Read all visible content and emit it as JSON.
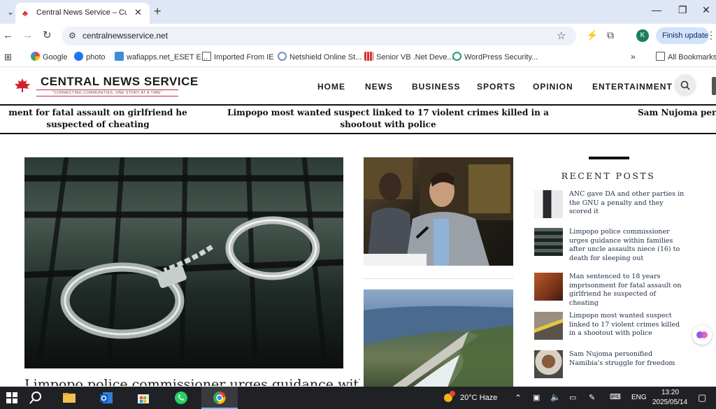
{
  "browser": {
    "tab_title": "Central News Service – Current",
    "url": "centralnewsservice.net",
    "update_label": "Finish update",
    "avatar_letter": "K",
    "bookmarks": [
      {
        "label": "Google",
        "icon": "google-icon"
      },
      {
        "label": "photo",
        "icon": "facebook-icon"
      },
      {
        "label": "wafiapps.net_ESET E...",
        "icon": "eset-icon"
      },
      {
        "label": "Imported From IE",
        "icon": "folder-icon"
      },
      {
        "label": "Netshield Online St...",
        "icon": "netshield-icon"
      },
      {
        "label": "Senior VB .Net Deve...",
        "icon": "grid-icon"
      },
      {
        "label": "WordPress Security...",
        "icon": "refresh-icon"
      }
    ],
    "all_bookmarks_label": "All Bookmarks"
  },
  "site": {
    "brand": "CENTRAL NEWS SERVICE",
    "tagline": "\"CONNECTING COMMUNITIES, ONE STORY AT A TIME\"",
    "nav": [
      "HOME",
      "NEWS",
      "BUSINESS",
      "SPORTS",
      "OPINION",
      "ENTERTAINMENT"
    ],
    "accent_color": "#c6283a"
  },
  "ticker": [
    "ment for fatal assault on girlfriend he suspected of cheating",
    "Limpopo most wanted suspect linked to 17 violent crimes killed in a shootout with police",
    "Sam Nujoma perso"
  ],
  "main": {
    "headline": "Limpopo police commissioner urges guidance within"
  },
  "sidebar": {
    "title": "RECENT POSTS",
    "posts": [
      {
        "title": "ANC gave DA and other parties in the GNU a penalty and they scored it"
      },
      {
        "title": "Limpopo police commissioner urges guidance within families after uncle assaults niece (16) to death for sleeping out"
      },
      {
        "title": "Man sentenced to 18 years imprisonment for fatal assault on girlfriend he suspected of cheating"
      },
      {
        "title": "Limpopo most wanted suspect linked to 17 violent crimes killed in a shootout with police"
      },
      {
        "title": "Sam Nujoma personified Namibia's struggle for freedom"
      }
    ]
  },
  "taskbar": {
    "weather": "20°C  Haze",
    "language": "ENG",
    "time": "13:20",
    "date": "2025/05/14"
  }
}
